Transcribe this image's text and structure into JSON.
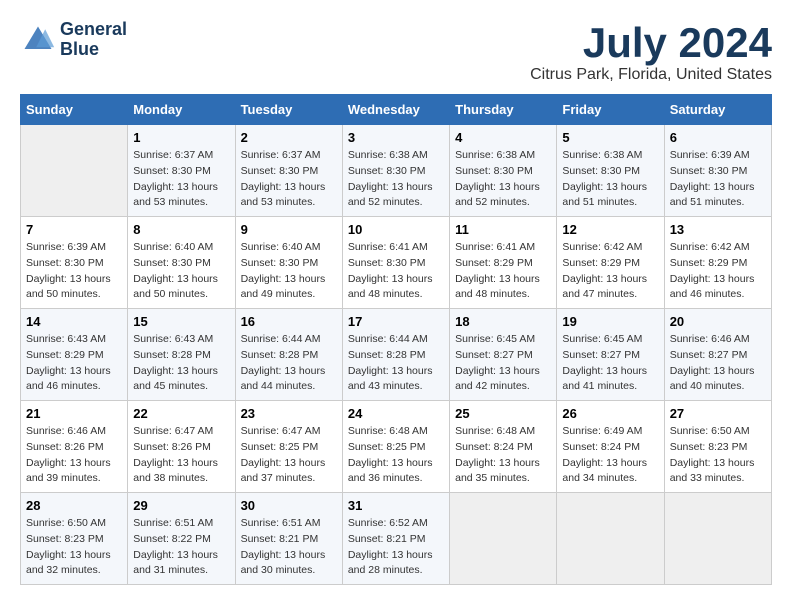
{
  "header": {
    "logo_line1": "General",
    "logo_line2": "Blue",
    "title": "July 2024",
    "subtitle": "Citrus Park, Florida, United States"
  },
  "days_of_week": [
    "Sunday",
    "Monday",
    "Tuesday",
    "Wednesday",
    "Thursday",
    "Friday",
    "Saturday"
  ],
  "weeks": [
    [
      {
        "day": "",
        "info": ""
      },
      {
        "day": "1",
        "info": "Sunrise: 6:37 AM\nSunset: 8:30 PM\nDaylight: 13 hours\nand 53 minutes."
      },
      {
        "day": "2",
        "info": "Sunrise: 6:37 AM\nSunset: 8:30 PM\nDaylight: 13 hours\nand 53 minutes."
      },
      {
        "day": "3",
        "info": "Sunrise: 6:38 AM\nSunset: 8:30 PM\nDaylight: 13 hours\nand 52 minutes."
      },
      {
        "day": "4",
        "info": "Sunrise: 6:38 AM\nSunset: 8:30 PM\nDaylight: 13 hours\nand 52 minutes."
      },
      {
        "day": "5",
        "info": "Sunrise: 6:38 AM\nSunset: 8:30 PM\nDaylight: 13 hours\nand 51 minutes."
      },
      {
        "day": "6",
        "info": "Sunrise: 6:39 AM\nSunset: 8:30 PM\nDaylight: 13 hours\nand 51 minutes."
      }
    ],
    [
      {
        "day": "7",
        "info": "Sunrise: 6:39 AM\nSunset: 8:30 PM\nDaylight: 13 hours\nand 50 minutes."
      },
      {
        "day": "8",
        "info": "Sunrise: 6:40 AM\nSunset: 8:30 PM\nDaylight: 13 hours\nand 50 minutes."
      },
      {
        "day": "9",
        "info": "Sunrise: 6:40 AM\nSunset: 8:30 PM\nDaylight: 13 hours\nand 49 minutes."
      },
      {
        "day": "10",
        "info": "Sunrise: 6:41 AM\nSunset: 8:30 PM\nDaylight: 13 hours\nand 48 minutes."
      },
      {
        "day": "11",
        "info": "Sunrise: 6:41 AM\nSunset: 8:29 PM\nDaylight: 13 hours\nand 48 minutes."
      },
      {
        "day": "12",
        "info": "Sunrise: 6:42 AM\nSunset: 8:29 PM\nDaylight: 13 hours\nand 47 minutes."
      },
      {
        "day": "13",
        "info": "Sunrise: 6:42 AM\nSunset: 8:29 PM\nDaylight: 13 hours\nand 46 minutes."
      }
    ],
    [
      {
        "day": "14",
        "info": "Sunrise: 6:43 AM\nSunset: 8:29 PM\nDaylight: 13 hours\nand 46 minutes."
      },
      {
        "day": "15",
        "info": "Sunrise: 6:43 AM\nSunset: 8:28 PM\nDaylight: 13 hours\nand 45 minutes."
      },
      {
        "day": "16",
        "info": "Sunrise: 6:44 AM\nSunset: 8:28 PM\nDaylight: 13 hours\nand 44 minutes."
      },
      {
        "day": "17",
        "info": "Sunrise: 6:44 AM\nSunset: 8:28 PM\nDaylight: 13 hours\nand 43 minutes."
      },
      {
        "day": "18",
        "info": "Sunrise: 6:45 AM\nSunset: 8:27 PM\nDaylight: 13 hours\nand 42 minutes."
      },
      {
        "day": "19",
        "info": "Sunrise: 6:45 AM\nSunset: 8:27 PM\nDaylight: 13 hours\nand 41 minutes."
      },
      {
        "day": "20",
        "info": "Sunrise: 6:46 AM\nSunset: 8:27 PM\nDaylight: 13 hours\nand 40 minutes."
      }
    ],
    [
      {
        "day": "21",
        "info": "Sunrise: 6:46 AM\nSunset: 8:26 PM\nDaylight: 13 hours\nand 39 minutes."
      },
      {
        "day": "22",
        "info": "Sunrise: 6:47 AM\nSunset: 8:26 PM\nDaylight: 13 hours\nand 38 minutes."
      },
      {
        "day": "23",
        "info": "Sunrise: 6:47 AM\nSunset: 8:25 PM\nDaylight: 13 hours\nand 37 minutes."
      },
      {
        "day": "24",
        "info": "Sunrise: 6:48 AM\nSunset: 8:25 PM\nDaylight: 13 hours\nand 36 minutes."
      },
      {
        "day": "25",
        "info": "Sunrise: 6:48 AM\nSunset: 8:24 PM\nDaylight: 13 hours\nand 35 minutes."
      },
      {
        "day": "26",
        "info": "Sunrise: 6:49 AM\nSunset: 8:24 PM\nDaylight: 13 hours\nand 34 minutes."
      },
      {
        "day": "27",
        "info": "Sunrise: 6:50 AM\nSunset: 8:23 PM\nDaylight: 13 hours\nand 33 minutes."
      }
    ],
    [
      {
        "day": "28",
        "info": "Sunrise: 6:50 AM\nSunset: 8:23 PM\nDaylight: 13 hours\nand 32 minutes."
      },
      {
        "day": "29",
        "info": "Sunrise: 6:51 AM\nSunset: 8:22 PM\nDaylight: 13 hours\nand 31 minutes."
      },
      {
        "day": "30",
        "info": "Sunrise: 6:51 AM\nSunset: 8:21 PM\nDaylight: 13 hours\nand 30 minutes."
      },
      {
        "day": "31",
        "info": "Sunrise: 6:52 AM\nSunset: 8:21 PM\nDaylight: 13 hours\nand 28 minutes."
      },
      {
        "day": "",
        "info": ""
      },
      {
        "day": "",
        "info": ""
      },
      {
        "day": "",
        "info": ""
      }
    ]
  ]
}
